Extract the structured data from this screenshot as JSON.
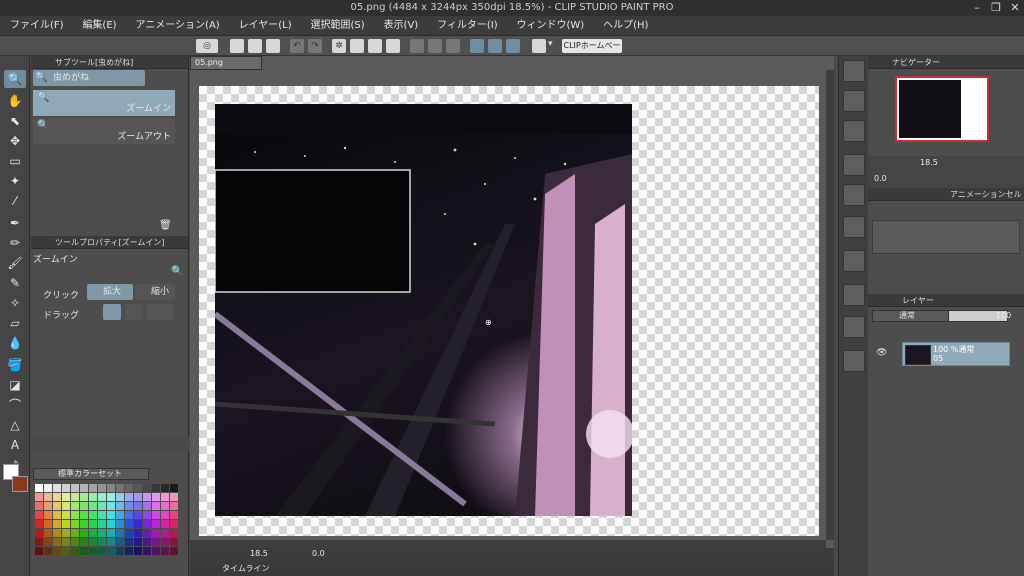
{
  "window": {
    "title": "05.png (4484 x 3244px 350dpi 18.5%) - CLIP STUDIO PAINT PRO"
  },
  "menu": [
    "ファイル(F)",
    "編集(E)",
    "アニメーション(A)",
    "レイヤー(L)",
    "選択範囲(S)",
    "表示(V)",
    "フィルター(I)",
    "ウィンドウ(W)",
    "ヘルプ(H)"
  ],
  "command_bar": {
    "clip_home": "CLIPホームページ"
  },
  "subtool": {
    "header": "サブツール[虫めがね]",
    "group": "虫めがね",
    "items": [
      "ズームイン",
      "ズームアウト"
    ]
  },
  "tool_property": {
    "header": "ツールプロパティ[ズームイン]",
    "name": "ズームイン",
    "click_label": "クリック",
    "drag_label": "ドラッグ",
    "zoom_in": "拡大",
    "zoom_out": "縮小"
  },
  "color_set": {
    "name": "標準カラーセット"
  },
  "document": {
    "tab": "05.png"
  },
  "canvas_footer": {
    "zoom": "18.5",
    "angle": "0.0"
  },
  "timeline": {
    "label": "タイムライン"
  },
  "navigator": {
    "header": "ナビゲーター",
    "zoom": "18.5",
    "angle": "0.0"
  },
  "animation_cel": {
    "header": "アニメーションセル"
  },
  "layers": {
    "header": "レイヤー",
    "blend_mode": "通常",
    "opacity": "100",
    "items": [
      {
        "opacity_mode": "100 %通常",
        "name": "05"
      }
    ]
  },
  "colors": {
    "accent": "#6e8da0",
    "layer_selected": "#8fa9b9",
    "nav_frame": "#c83030"
  }
}
